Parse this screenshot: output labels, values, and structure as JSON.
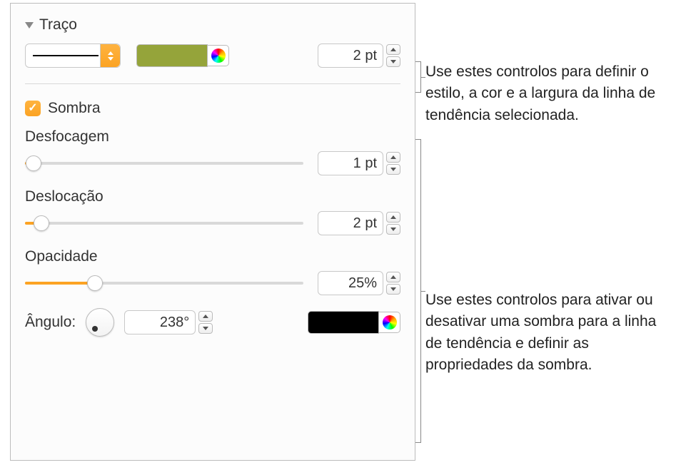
{
  "stroke": {
    "title": "Traço",
    "width_value": "2 pt",
    "color": "#95a43a"
  },
  "shadow": {
    "label": "Sombra",
    "checked": true,
    "blur": {
      "label": "Desfocagem",
      "value": "1 pt",
      "percent": 3
    },
    "offset": {
      "label": "Deslocação",
      "value": "2 pt",
      "percent": 6
    },
    "opacity": {
      "label": "Opacidade",
      "value": "25%",
      "percent": 25
    },
    "angle": {
      "label": "Ângulo:",
      "value": "238°"
    },
    "color": "#000000"
  },
  "callouts": {
    "stroke": "Use estes controlos para definir o estilo, a cor e a largura da linha de tendência selecionada.",
    "shadow": "Use estes controlos para ativar ou desativar uma sombra para a linha de tendência e definir as propriedades da sombra."
  }
}
